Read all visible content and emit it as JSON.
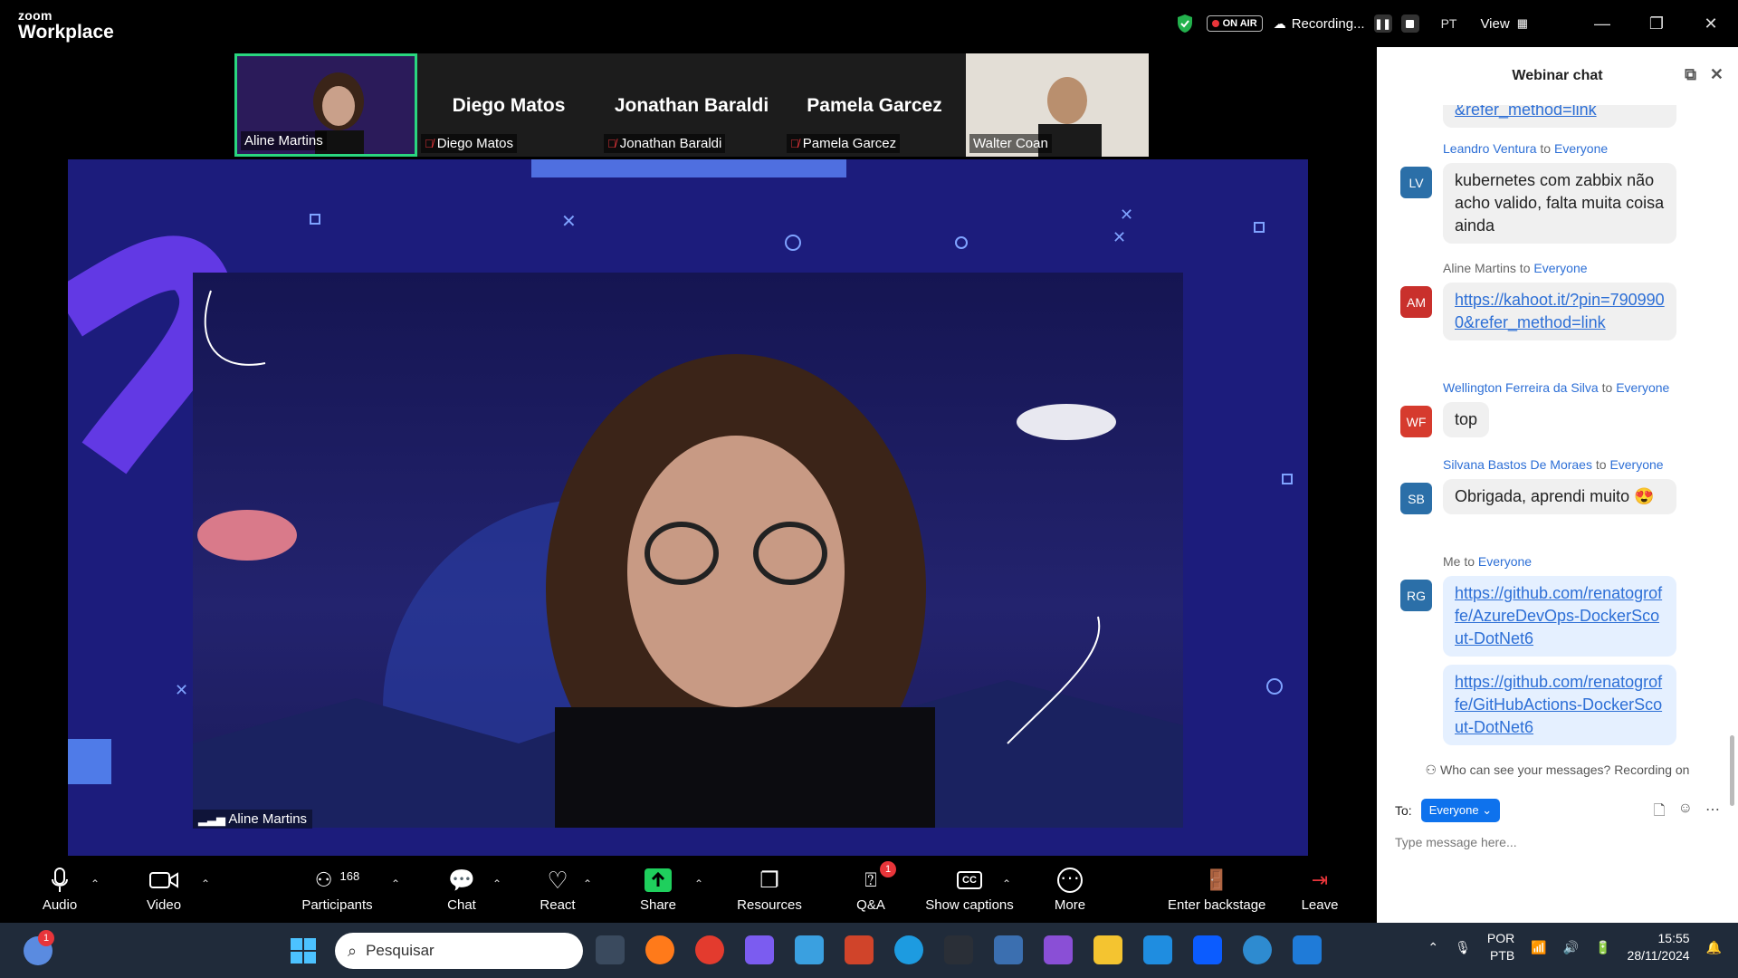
{
  "app": {
    "brand_top": "zoom",
    "brand_bottom": "Workplace"
  },
  "topbar": {
    "on_air": "ON AIR",
    "recording": "Recording...",
    "language": "PT",
    "view": "View"
  },
  "participants_strip": [
    {
      "name": "Aline Martins",
      "big": "",
      "active": true,
      "muted": false
    },
    {
      "name": "Diego Matos",
      "big": "Diego Matos",
      "active": false,
      "muted": true
    },
    {
      "name": "Jonathan Baraldi",
      "big": "Jonathan Baraldi",
      "active": false,
      "muted": true
    },
    {
      "name": "Pamela Garcez",
      "big": "Pamela Garcez",
      "active": false,
      "muted": true
    },
    {
      "name": "Walter Coan",
      "big": "",
      "active": false,
      "muted": false
    }
  ],
  "main_video": {
    "speaker": "Aline Martins"
  },
  "chat": {
    "title": "Webinar chat",
    "partial_top": "&refer_method=link",
    "messages": [
      {
        "sender": "Leandro Ventura",
        "to": "Everyone",
        "initials": "LV",
        "color": "#2b6fa8",
        "text": "kubernetes com zabbix não acho valido, falta muita coisa ainda"
      },
      {
        "sender": "Aline Martins",
        "to": "Everyone",
        "initials": "AM",
        "color": "#c9302c",
        "text": "https://kahoot.it/?pin=7909900&refer_method=link",
        "link": true
      },
      {
        "sender": "Wellington Ferreira da Silva",
        "to": "Everyone",
        "initials": "WF",
        "color": "#d63b2e",
        "text": "top"
      },
      {
        "sender": "Silvana Bastos De Moraes",
        "to": "Everyone",
        "initials": "SB",
        "color": "#2b6fa8",
        "text": "Obrigada, aprendi muito 😍"
      },
      {
        "sender": "Me",
        "to": "Everyone",
        "initials": "RG",
        "color": "#2b6fa8",
        "text": "https://github.com/renatogroffe/AzureDevOps-DockerScout-DotNet6",
        "link": true,
        "me": true
      },
      {
        "sender": "",
        "to": "",
        "initials": "",
        "color": "",
        "text": "https://github.com/renatogroffe/GitHubActions-DockerScout-DotNet6",
        "link": true,
        "me": true
      }
    ],
    "notice": "Who can see your messages? Recording on",
    "to_label": "To:",
    "to_value": "Everyone",
    "placeholder": "Type message here..."
  },
  "toolbar": {
    "audio": "Audio",
    "video": "Video",
    "participants": "Participants",
    "participants_count": "168",
    "chat": "Chat",
    "react": "React",
    "share": "Share",
    "resources": "Resources",
    "qa": "Q&A",
    "qa_badge": "1",
    "captions": "Show captions",
    "more": "More",
    "backstage": "Enter backstage",
    "leave": "Leave"
  },
  "taskbar": {
    "search": "Pesquisar",
    "lang1": "POR",
    "lang2": "PTB",
    "time": "15:55",
    "date": "28/11/2024",
    "notif_badge": "1"
  }
}
